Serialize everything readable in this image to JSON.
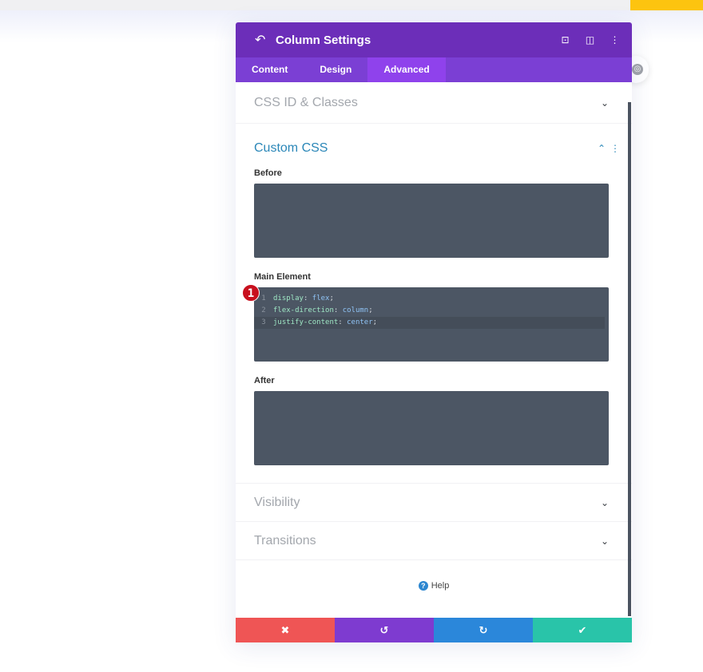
{
  "header": {
    "title": "Column Settings",
    "icons": [
      "back-icon",
      "focus-icon",
      "split-view-icon",
      "more-icon"
    ]
  },
  "tabs": [
    {
      "label": "Content"
    },
    {
      "label": "Design"
    },
    {
      "label": "Advanced",
      "active": true
    }
  ],
  "sections": {
    "css_id": "CSS ID & Classes",
    "custom_css": "Custom CSS",
    "visibility": "Visibility",
    "transitions": "Transitions"
  },
  "fields": {
    "before": "Before",
    "main": "Main Element",
    "after": "After"
  },
  "code": [
    {
      "n": "1",
      "prop": "display",
      "val": "flex"
    },
    {
      "n": "2",
      "prop": "flex-direction",
      "val": "column"
    },
    {
      "n": "3",
      "prop": "justify-content",
      "val": "center"
    }
  ],
  "badge": "1",
  "help": "Help",
  "footer": {
    "colors": {
      "cancel": "#ef5555",
      "undo": "#7e3bd0",
      "redo": "#2b87da",
      "save": "#29c4a9"
    }
  },
  "colors": {
    "header": "#6c2eb9",
    "tabs": "#7b3fd4",
    "active_tab": "#8f42ec",
    "accent_title": "#2b87b8"
  }
}
